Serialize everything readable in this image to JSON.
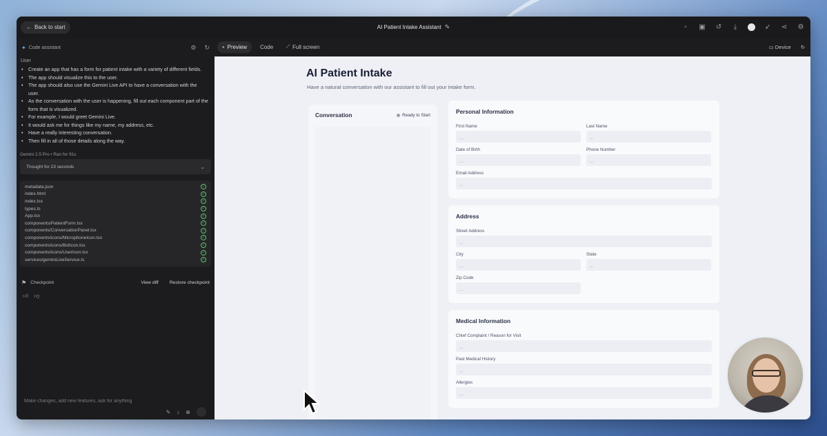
{
  "topbar": {
    "back_label": "Back to start",
    "app_title": "AI Patient Intake Assistant"
  },
  "left_panel": {
    "header_label": "Code assistant",
    "user_label": "User",
    "prompt_bullets": [
      "Create an app that has a form for patient intake with a variety of different fields.",
      "The app should visualize this to the user.",
      "The app should also use the Gemini Live API to have a conversation with the user.",
      "As the conversation with the user is happening, fill out each component part of the form that is visualized.",
      "For example, I would greet Gemini Live.",
      "It would ask me for things like my name, my address, etc.",
      "Have a really interesting conversation.",
      "Then fill in all of those details along the way."
    ],
    "model_line": "Gemini 2.5 Pro  •  Ran for 91s",
    "thought_label": "Thought for 23 seconds",
    "files": [
      "metadata.json",
      "index.html",
      "index.tsx",
      "types.ts",
      "App.tsx",
      "components/PatientForm.tsx",
      "components/ConversationPanel.tsx",
      "components/icons/MicrophoneIcon.tsx",
      "components/icons/BotIcon.tsx",
      "components/icons/UserIcon.tsx",
      "services/geminiLiveService.ts"
    ],
    "checkpoint_label": "Checkpoint",
    "view_diff_label": "View diff",
    "restore_label": "Restore checkpoint",
    "chat_placeholder": "Make changes, add new features, ask for anything"
  },
  "tabs": {
    "preview": "Preview",
    "code": "Code",
    "fullscreen": "Full screen",
    "device": "Device"
  },
  "preview": {
    "title": "AI Patient Intake",
    "subtitle": "Have a natural conversation with our assistant to fill out your intake form.",
    "conversation": {
      "title": "Conversation",
      "status": "Ready to Start"
    },
    "sections": {
      "personal": {
        "title": "Personal Information",
        "first_name": "First Name",
        "last_name": "Last Name",
        "dob": "Date of Birth",
        "phone": "Phone Number",
        "email": "Email Address"
      },
      "address": {
        "title": "Address",
        "street": "Street Address",
        "city": "City",
        "state": "State",
        "zip": "Zip Code"
      },
      "medical": {
        "title": "Medical Information",
        "complaint": "Chief Complaint / Reason for Visit",
        "history": "Past Medical History",
        "allergies": "Allergies"
      }
    },
    "empty_value": "..."
  }
}
